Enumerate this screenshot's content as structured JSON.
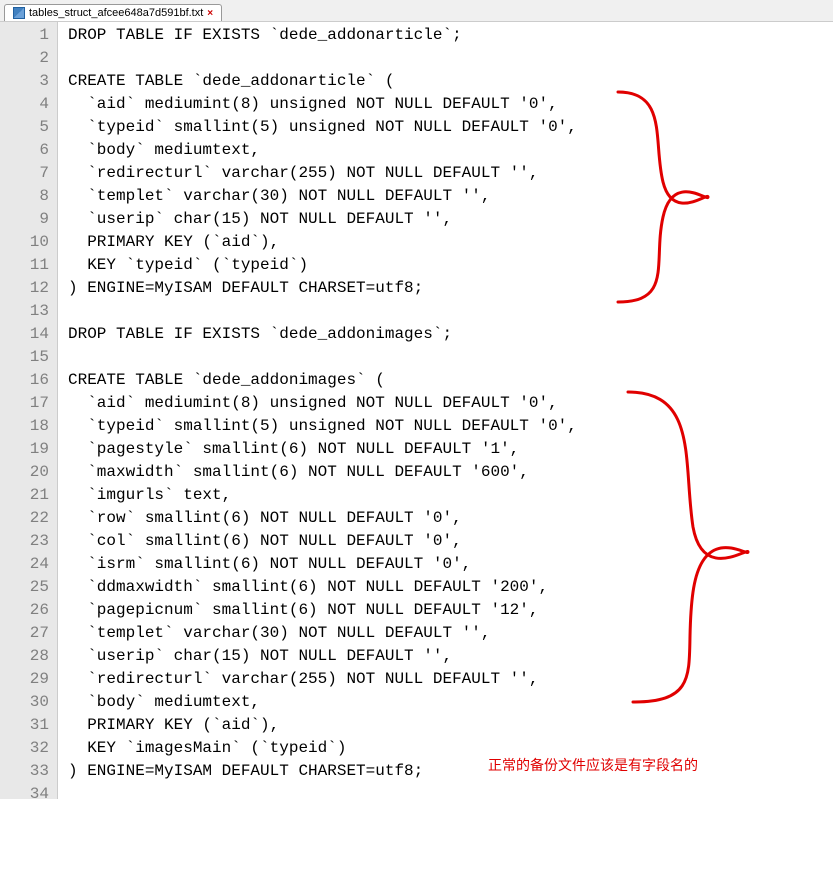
{
  "tab": {
    "filename": "tables_struct_afcee648a7d591bf.txt",
    "close": "×"
  },
  "lines": [
    "DROP TABLE IF EXISTS `dede_addonarticle`;",
    "",
    "CREATE TABLE `dede_addonarticle` (",
    "  `aid` mediumint(8) unsigned NOT NULL DEFAULT '0',",
    "  `typeid` smallint(5) unsigned NOT NULL DEFAULT '0',",
    "  `body` mediumtext,",
    "  `redirecturl` varchar(255) NOT NULL DEFAULT '',",
    "  `templet` varchar(30) NOT NULL DEFAULT '',",
    "  `userip` char(15) NOT NULL DEFAULT '',",
    "  PRIMARY KEY (`aid`),",
    "  KEY `typeid` (`typeid`)",
    ") ENGINE=MyISAM DEFAULT CHARSET=utf8;",
    "",
    "DROP TABLE IF EXISTS `dede_addonimages`;",
    "",
    "CREATE TABLE `dede_addonimages` (",
    "  `aid` mediumint(8) unsigned NOT NULL DEFAULT '0',",
    "  `typeid` smallint(5) unsigned NOT NULL DEFAULT '0',",
    "  `pagestyle` smallint(6) NOT NULL DEFAULT '1',",
    "  `maxwidth` smallint(6) NOT NULL DEFAULT '600',",
    "  `imgurls` text,",
    "  `row` smallint(6) NOT NULL DEFAULT '0',",
    "  `col` smallint(6) NOT NULL DEFAULT '0',",
    "  `isrm` smallint(6) NOT NULL DEFAULT '0',",
    "  `ddmaxwidth` smallint(6) NOT NULL DEFAULT '200',",
    "  `pagepicnum` smallint(6) NOT NULL DEFAULT '12',",
    "  `templet` varchar(30) NOT NULL DEFAULT '',",
    "  `userip` char(15) NOT NULL DEFAULT '',",
    "  `redirecturl` varchar(255) NOT NULL DEFAULT '',",
    "  `body` mediumtext,",
    "  PRIMARY KEY (`aid`),",
    "  KEY `imagesMain` (`typeid`)",
    ") ENGINE=MyISAM DEFAULT CHARSET=utf8;"
  ],
  "annotation_text": "正常的备份文件应该是有字段名的",
  "line_count": 34
}
